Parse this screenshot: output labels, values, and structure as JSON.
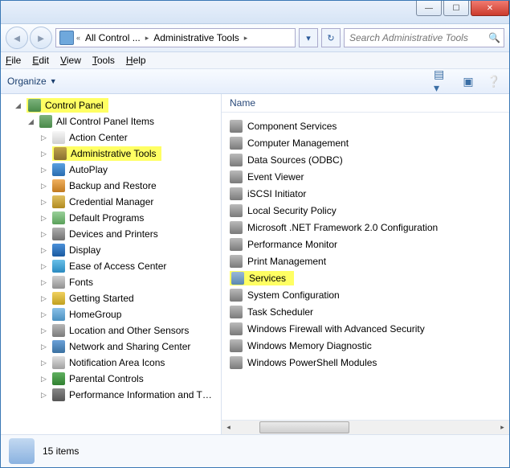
{
  "titlebar": {
    "min": "—",
    "max": "☐",
    "close": "✕"
  },
  "nav": {
    "breadcrumb": [
      "All Control ...",
      "Administrative Tools"
    ],
    "search_placeholder": "Search Administrative Tools"
  },
  "menu": {
    "file": "File",
    "edit": "Edit",
    "view": "View",
    "tools": "Tools",
    "help": "Help"
  },
  "toolbar": {
    "organize": "Organize"
  },
  "tree": [
    {
      "indent": 0,
      "label": "Control Panel",
      "icon": "i-cp",
      "twisty": "◢",
      "hl": true
    },
    {
      "indent": 1,
      "label": "All Control Panel Items",
      "icon": "i-cp",
      "twisty": "◢"
    },
    {
      "indent": 2,
      "label": "Action Center",
      "icon": "i-flag",
      "twisty": "▷"
    },
    {
      "indent": 2,
      "label": "Administrative Tools",
      "icon": "i-tools",
      "twisty": "▷",
      "hl": true
    },
    {
      "indent": 2,
      "label": "AutoPlay",
      "icon": "i-play",
      "twisty": "▷"
    },
    {
      "indent": 2,
      "label": "Backup and Restore",
      "icon": "i-backup",
      "twisty": "▷"
    },
    {
      "indent": 2,
      "label": "Credential Manager",
      "icon": "i-cred",
      "twisty": "▷"
    },
    {
      "indent": 2,
      "label": "Default Programs",
      "icon": "i-def",
      "twisty": "▷"
    },
    {
      "indent": 2,
      "label": "Devices and Printers",
      "icon": "i-dev",
      "twisty": "▷"
    },
    {
      "indent": 2,
      "label": "Display",
      "icon": "i-disp",
      "twisty": "▷"
    },
    {
      "indent": 2,
      "label": "Ease of Access Center",
      "icon": "i-ease",
      "twisty": "▷"
    },
    {
      "indent": 2,
      "label": "Fonts",
      "icon": "i-font",
      "twisty": "▷"
    },
    {
      "indent": 2,
      "label": "Getting Started",
      "icon": "i-start",
      "twisty": "▷"
    },
    {
      "indent": 2,
      "label": "HomeGroup",
      "icon": "i-home",
      "twisty": "▷"
    },
    {
      "indent": 2,
      "label": "Location and Other Sensors",
      "icon": "i-loc",
      "twisty": "▷"
    },
    {
      "indent": 2,
      "label": "Network and Sharing Center",
      "icon": "i-net",
      "twisty": "▷"
    },
    {
      "indent": 2,
      "label": "Notification Area Icons",
      "icon": "i-notif",
      "twisty": "▷"
    },
    {
      "indent": 2,
      "label": "Parental Controls",
      "icon": "i-parent",
      "twisty": "▷"
    },
    {
      "indent": 2,
      "label": "Performance Information and T…",
      "icon": "i-perf",
      "twisty": "▷"
    }
  ],
  "list_header": "Name",
  "items": [
    {
      "label": "Component Services",
      "icon": "i-gear"
    },
    {
      "label": "Computer Management",
      "icon": "i-gear"
    },
    {
      "label": "Data Sources (ODBC)",
      "icon": "i-gear"
    },
    {
      "label": "Event Viewer",
      "icon": "i-gear"
    },
    {
      "label": "iSCSI Initiator",
      "icon": "i-gear"
    },
    {
      "label": "Local Security Policy",
      "icon": "i-gear"
    },
    {
      "label": "Microsoft .NET Framework 2.0 Configuration",
      "icon": "i-gear"
    },
    {
      "label": "Performance Monitor",
      "icon": "i-gear"
    },
    {
      "label": "Print Management",
      "icon": "i-gear"
    },
    {
      "label": "Services",
      "icon": "i-svc",
      "hl": true
    },
    {
      "label": "System Configuration",
      "icon": "i-gear"
    },
    {
      "label": "Task Scheduler",
      "icon": "i-gear"
    },
    {
      "label": "Windows Firewall with Advanced Security",
      "icon": "i-gear"
    },
    {
      "label": "Windows Memory Diagnostic",
      "icon": "i-gear"
    },
    {
      "label": "Windows PowerShell Modules",
      "icon": "i-gear"
    }
  ],
  "status": {
    "count": "15 items"
  }
}
